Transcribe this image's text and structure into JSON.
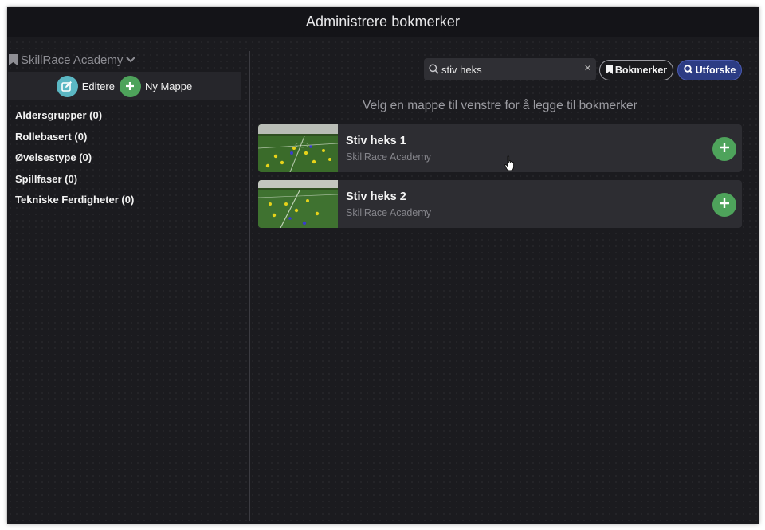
{
  "window": {
    "title": "Administrere bokmerker"
  },
  "sidebar": {
    "workspace": "SkillRace Academy",
    "edit_label": "Editere",
    "new_folder_label": "Ny Mappe",
    "folders": [
      "Aldersgrupper (0)",
      "Rollebasert (0)",
      "Øvelsestype (0)",
      "Spillfaser (0)",
      "Tekniske Ferdigheter (0)"
    ]
  },
  "search": {
    "value": "stiv heks",
    "clear_glyph": "×"
  },
  "buttons": {
    "bookmarks_label": "Bokmerker",
    "explore_label": "Utforske"
  },
  "main": {
    "hint": "Velg en mappe til venstre for å legge til bokmerker",
    "results": [
      {
        "title": "Stiv heks 1",
        "subtitle": "SkillRace Academy"
      },
      {
        "title": "Stiv heks 2",
        "subtitle": "SkillRace Academy"
      }
    ]
  },
  "colors": {
    "background": "#1b1b1f",
    "accent_green": "#4ea35b",
    "accent_teal": "#5bb7c3",
    "explore_blue": "#2c3c84"
  },
  "icons": {
    "workspace": "bookmark-icon",
    "workspace_dropdown": "chevron-down-icon",
    "edit": "edit-icon",
    "new_folder": "plus-icon",
    "search": "search-icon",
    "clear": "close-icon",
    "bookmarks": "bookmark-icon",
    "explore": "search-icon",
    "card_add": "plus-icon",
    "cursor": "hand-pointer-icon"
  }
}
